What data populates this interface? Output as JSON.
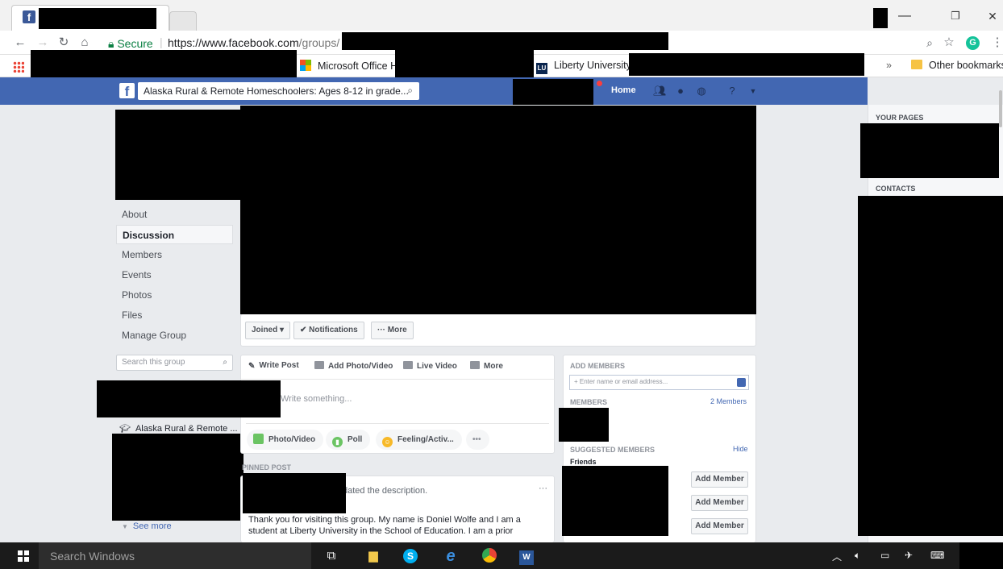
{
  "browser": {
    "address": {
      "secure_label": "Secure",
      "url_host": "https://www.facebook.com",
      "url_path": "/groups/"
    },
    "bookmarks": {
      "office": "Microsoft Office H",
      "liberty": "Liberty University",
      "overflow": "»",
      "other": "Other bookmarks"
    },
    "window_controls": {
      "minimize": "—",
      "restore": "❐",
      "close": "✕"
    }
  },
  "fb": {
    "search_text": "Alaska Rural & Remote Homeschoolers: Ages 8-12 in grade...",
    "home_label": "Home"
  },
  "left_nav": {
    "items": [
      "About",
      "Discussion",
      "Members",
      "Events",
      "Photos",
      "Files",
      "Manage Group"
    ],
    "active_index": 1,
    "search_placeholder": "Search this group",
    "group_shortcut": "Alaska Rural & Remote ...",
    "see_more": "See more"
  },
  "cover_actions": {
    "joined": "Joined ▾",
    "notifications": "✔ Notifications",
    "more": "··· More"
  },
  "composer": {
    "tabs": [
      "Write Post",
      "Add Photo/Video",
      "Live Video",
      "More"
    ],
    "placeholder": "Write something...",
    "pills": [
      "Photo/Video",
      "Poll",
      "Feeling/Activ...",
      "•••"
    ]
  },
  "pinned": {
    "header": "PINNED POST",
    "updated": "dated the description.",
    "menu": "···",
    "body": "Thank you for visiting this group. My name is Doniel Wolfe and I am a student at Liberty University in the School of Education. I am a prior"
  },
  "members_panel": {
    "add_members_title": "ADD MEMBERS",
    "add_placeholder": "+ Enter name or email address...",
    "members_title": "MEMBERS",
    "members_count": "2 Members",
    "suggested_title": "SUGGESTED MEMBERS",
    "hide": "Hide",
    "friends": "Friends",
    "add_member_label": "Add Member"
  },
  "right_rail": {
    "your_pages": "YOUR PAGES",
    "contacts": "CONTACTS"
  },
  "taskbar": {
    "search": "Search Windows"
  }
}
